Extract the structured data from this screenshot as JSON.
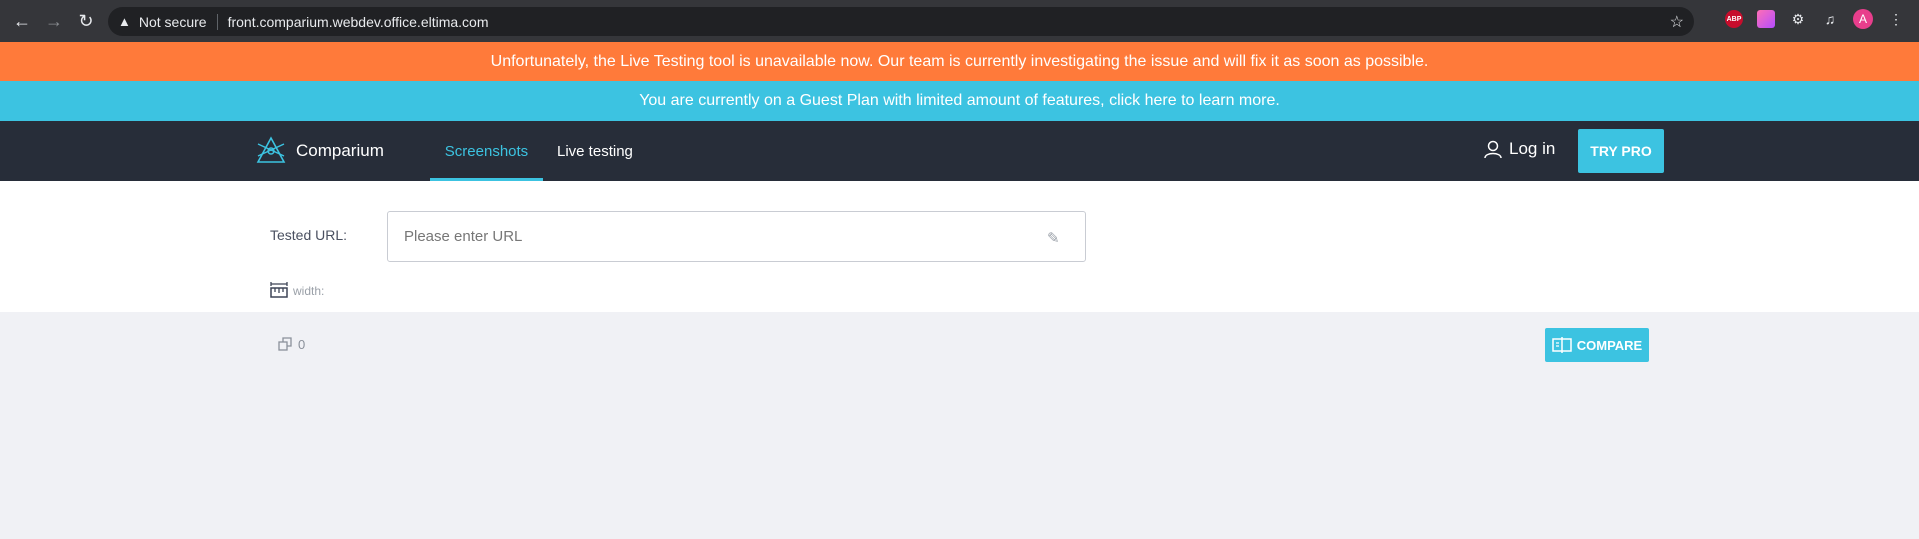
{
  "browser": {
    "not_secure": "Not secure",
    "url": "front.comparium.webdev.office.eltima.com",
    "abp_label": "ABP",
    "avatar_letter": "A",
    "icons": [
      "back-icon",
      "forward-icon",
      "reload-icon",
      "warning-icon",
      "star-icon",
      "adblock-icon",
      "extension-icon",
      "puzzle-icon",
      "media-icon",
      "menu-icon"
    ]
  },
  "banners": {
    "unavailable": "Unfortunately, the Live Testing tool is unavailable now. Our team is currently investigating the issue and will fix it as soon as possible.",
    "guest_plan": "You are currently on a Guest Plan with limited amount of features, click here to learn more."
  },
  "header": {
    "brand": "Comparium",
    "tabs": [
      {
        "label": "Screenshots",
        "active": true
      },
      {
        "label": "Live testing",
        "active": false
      }
    ],
    "login_label": "Log in",
    "try_pro_label": "TRY PRO"
  },
  "form": {
    "tested_url_label": "Tested URL:",
    "url_placeholder": "Please enter URL",
    "url_value": "",
    "width_label": "width:"
  },
  "controls": {
    "selected_count": "0",
    "compare_label": "COMPARE"
  },
  "colors": {
    "orange_banner": "#ff7a3a",
    "blue_banner": "#3cc3e1",
    "header_bg": "#272d39",
    "accent": "#3cc3e1",
    "page_bg": "#f0f1f5"
  }
}
